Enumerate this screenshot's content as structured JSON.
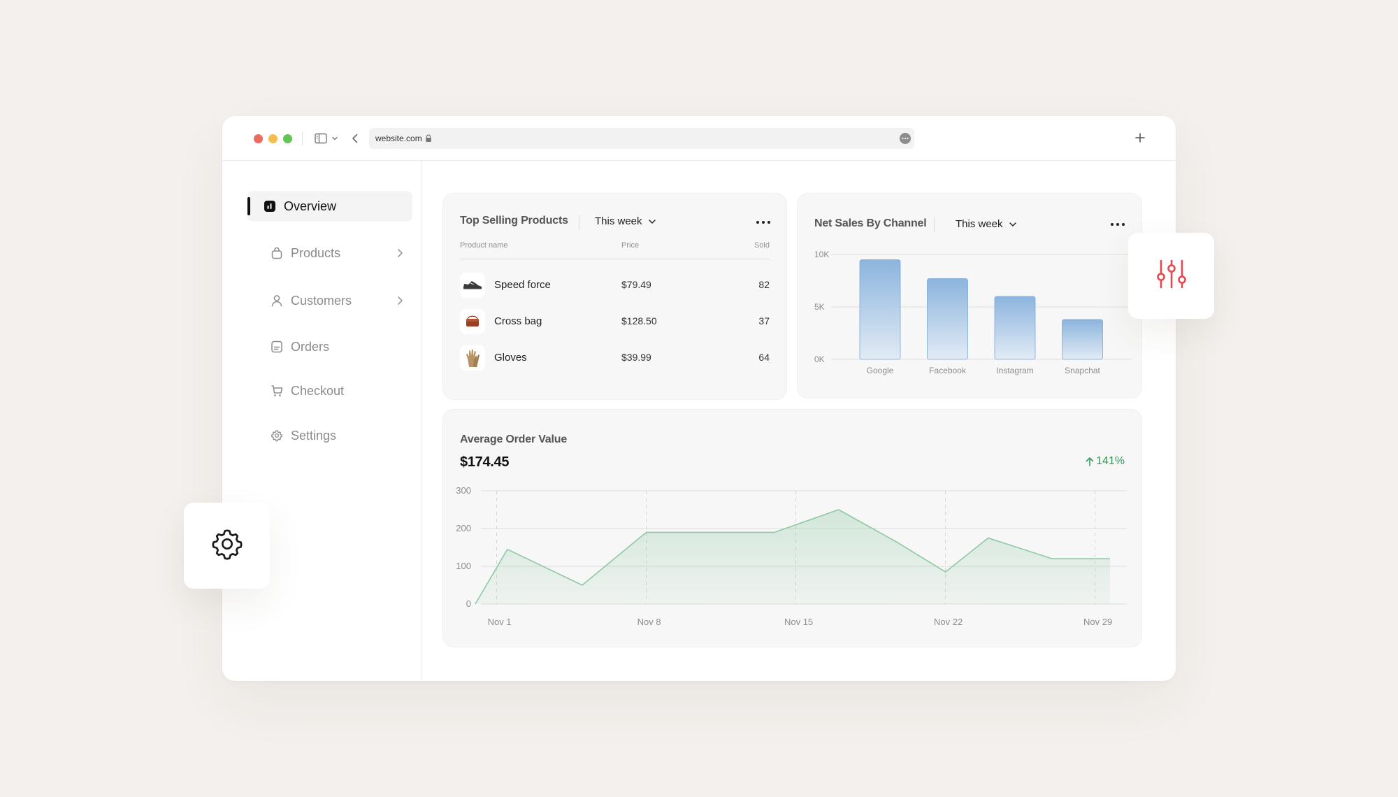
{
  "browser": {
    "url": "website.com"
  },
  "sidebar": {
    "items": [
      {
        "label": "Overview",
        "icon": "chart-square-icon",
        "active": true
      },
      {
        "label": "Products",
        "icon": "bag-icon",
        "has_submenu": true
      },
      {
        "label": "Customers",
        "icon": "user-icon",
        "has_submenu": true
      },
      {
        "label": "Orders",
        "icon": "document-icon"
      },
      {
        "label": "Checkout",
        "icon": "cart-icon"
      },
      {
        "label": "Settings",
        "icon": "gear-icon"
      }
    ]
  },
  "top_products": {
    "title": "Top Selling Products",
    "period": "This week",
    "columns": [
      "Product name",
      "Price",
      "Sold"
    ],
    "rows": [
      {
        "name": "Speed force",
        "price": "$79.49",
        "sold": "82",
        "icon": "sneaker-icon"
      },
      {
        "name": "Cross bag",
        "price": "$128.50",
        "sold": "37",
        "icon": "bag-product-icon"
      },
      {
        "name": "Gloves",
        "price": "$39.99",
        "sold": "64",
        "icon": "gloves-icon"
      }
    ]
  },
  "net_sales": {
    "title": "Net Sales By Channel",
    "period": "This week"
  },
  "average_order": {
    "title": "Average Order Value",
    "value": "$174.45",
    "change": "141%"
  },
  "chart_data": [
    {
      "type": "bar",
      "categories": [
        "Google",
        "Facebook",
        "Instagram",
        "Snapchat"
      ],
      "values": [
        9500,
        7700,
        6000,
        3800
      ],
      "ylim": [
        0,
        10000
      ],
      "yticks": [
        {
          "value": 0,
          "label": "0K"
        },
        {
          "value": 5000,
          "label": "5K"
        },
        {
          "value": 10000,
          "label": "10K"
        }
      ],
      "grid": true,
      "color": "#8cb4de"
    },
    {
      "type": "area",
      "x": [
        0,
        1.5,
        5,
        8,
        11,
        14,
        17,
        19.7,
        22,
        24,
        27,
        29.7
      ],
      "values": [
        0,
        145,
        50,
        190,
        190,
        190,
        250,
        165,
        85,
        175,
        120,
        120
      ],
      "ylim": [
        0,
        300
      ],
      "yticks": [
        0,
        100,
        200,
        300
      ],
      "xticks": [
        {
          "x": 1,
          "label": "Nov 1"
        },
        {
          "x": 8,
          "label": "Nov 8"
        },
        {
          "x": 15,
          "label": "Nov 15"
        },
        {
          "x": 22,
          "label": "Nov 22"
        },
        {
          "x": 29,
          "label": "Nov 29"
        }
      ],
      "grid": true,
      "color": "#8fc8a4"
    }
  ],
  "colors": {
    "accent_red": "#e5484d",
    "positive_green": "#2f9c5c",
    "bar_blue": "#8cb4de"
  }
}
